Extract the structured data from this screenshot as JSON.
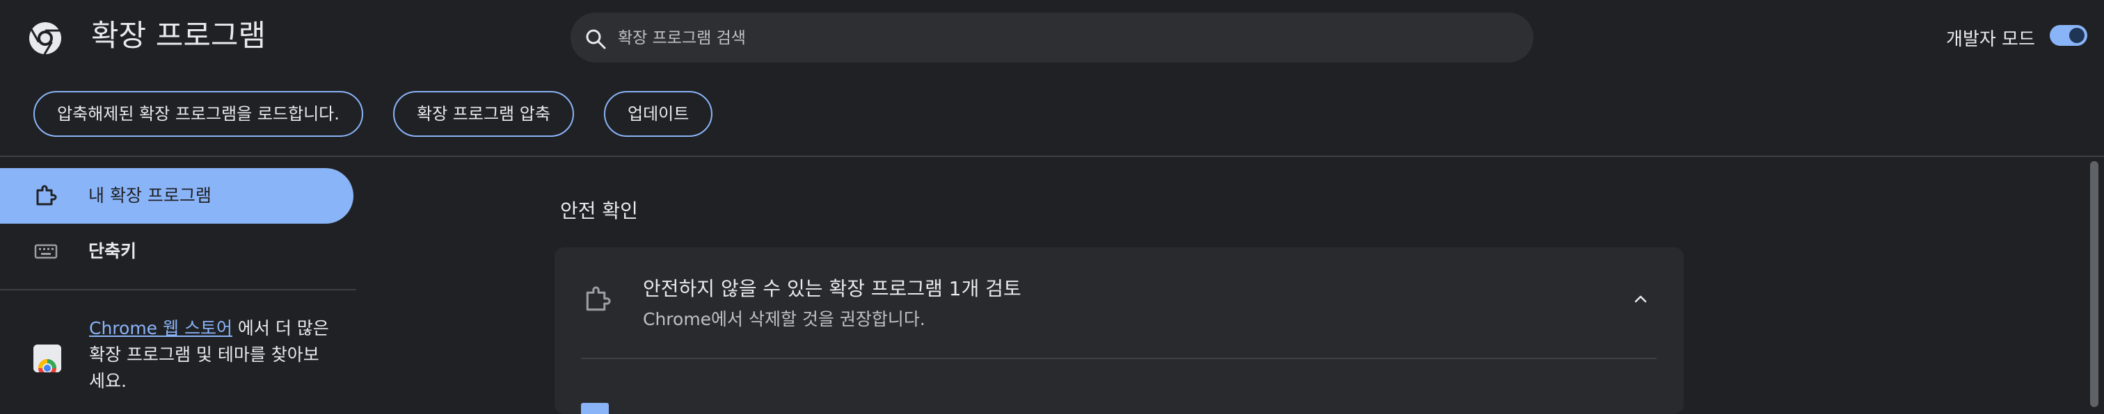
{
  "header": {
    "title": "확장 프로그램",
    "search_placeholder": "확장 프로그램 검색",
    "dev_mode_label": "개발자 모드",
    "dev_mode_on": true
  },
  "toolbar": {
    "load_unpacked": "압축해제된 확장 프로그램을 로드합니다.",
    "pack_extension": "확장 프로그램 압축",
    "update": "업데이트"
  },
  "sidebar": {
    "items": [
      {
        "label": "내 확장 프로그램",
        "icon": "puzzle-icon",
        "active": true
      },
      {
        "label": "단축키",
        "icon": "keyboard-icon",
        "active": false
      }
    ],
    "store_link": "Chrome 웹 스토어",
    "store_text_1": "에서 더 많은",
    "store_text_2": "확장 프로그램 및 테마를 찾아보",
    "store_text_3": "세요."
  },
  "main": {
    "section_title": "안전 확인",
    "card": {
      "title": "안전하지 않을 수 있는 확장 프로그램 1개 검토",
      "subtitle": "Chrome에서 삭제할 것을 권장합니다.",
      "expanded": true
    }
  },
  "colors": {
    "background": "#202124",
    "accent": "#8ab4f8",
    "card": "#292a2d",
    "divider": "#3c4043"
  }
}
